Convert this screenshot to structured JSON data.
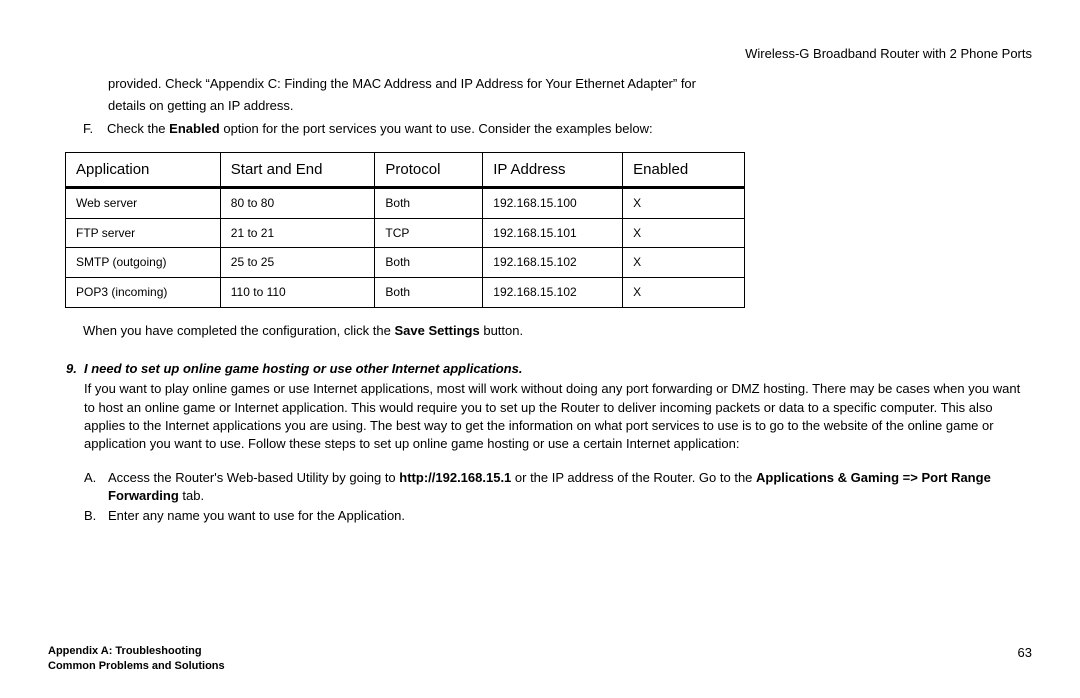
{
  "header": {
    "title": "Wireless-G Broadband Router with 2 Phone Ports"
  },
  "intro": {
    "line1": "provided. Check “Appendix C: Finding the MAC Address and IP Address for Your Ethernet Adapter” for",
    "line2": "details on getting an IP address.",
    "f_letter": "F.",
    "f_prefix": "Check the ",
    "f_bold": "Enabled",
    "f_suffix": " option for the port services you want to use. Consider the examples below:"
  },
  "table": {
    "headers": {
      "app": "Application",
      "se": "Start and End",
      "proto": "Protocol",
      "ip": "IP Address",
      "en": "Enabled"
    },
    "rows": [
      {
        "app": "Web server",
        "se": "80 to 80",
        "proto": "Both",
        "ip": "192.168.15.100",
        "en": "X"
      },
      {
        "app": "FTP server",
        "se": "21 to 21",
        "proto": "TCP",
        "ip": "192.168.15.101",
        "en": "X"
      },
      {
        "app": "SMTP (outgoing)",
        "se": "25 to 25",
        "proto": "Both",
        "ip": "192.168.15.102",
        "en": "X"
      },
      {
        "app": "POP3 (incoming)",
        "se": "110 to 110",
        "proto": "Both",
        "ip": "192.168.15.102",
        "en": "X"
      }
    ]
  },
  "save": {
    "prefix": "When you have completed the configuration, click the ",
    "bold": "Save Settings",
    "suffix": " button."
  },
  "question": {
    "num": "9.",
    "text": "I need to set up online game hosting or use other Internet applications."
  },
  "answer": {
    "text": "If you want to play online games or use Internet applications, most will work without doing any port forwarding or DMZ hosting. There may be cases when you want to host an online game or Internet application. This would require you to set up the Router to deliver incoming packets or data to a specific computer. This also applies to the Internet applications you are using. The best way to get the information on what port services to use is to go to the website of the online game or application you want to use. Follow these steps to set up online game hosting or use a certain Internet application:"
  },
  "steps": {
    "a_letter": "A.",
    "a_prefix": "Access the Router's Web-based Utility by going to ",
    "a_bold1": "http://192.168.15.1",
    "a_mid": " or the IP address of the Router. Go to the ",
    "a_bold2": "Applications & Gaming => Port Range Forwarding",
    "a_suffix": " tab.",
    "b_letter": "B.",
    "b_text": "Enter any name you want to use for the Application."
  },
  "footer": {
    "line1": "Appendix A: Troubleshooting",
    "line2": "Common Problems and Solutions",
    "page": "63"
  }
}
